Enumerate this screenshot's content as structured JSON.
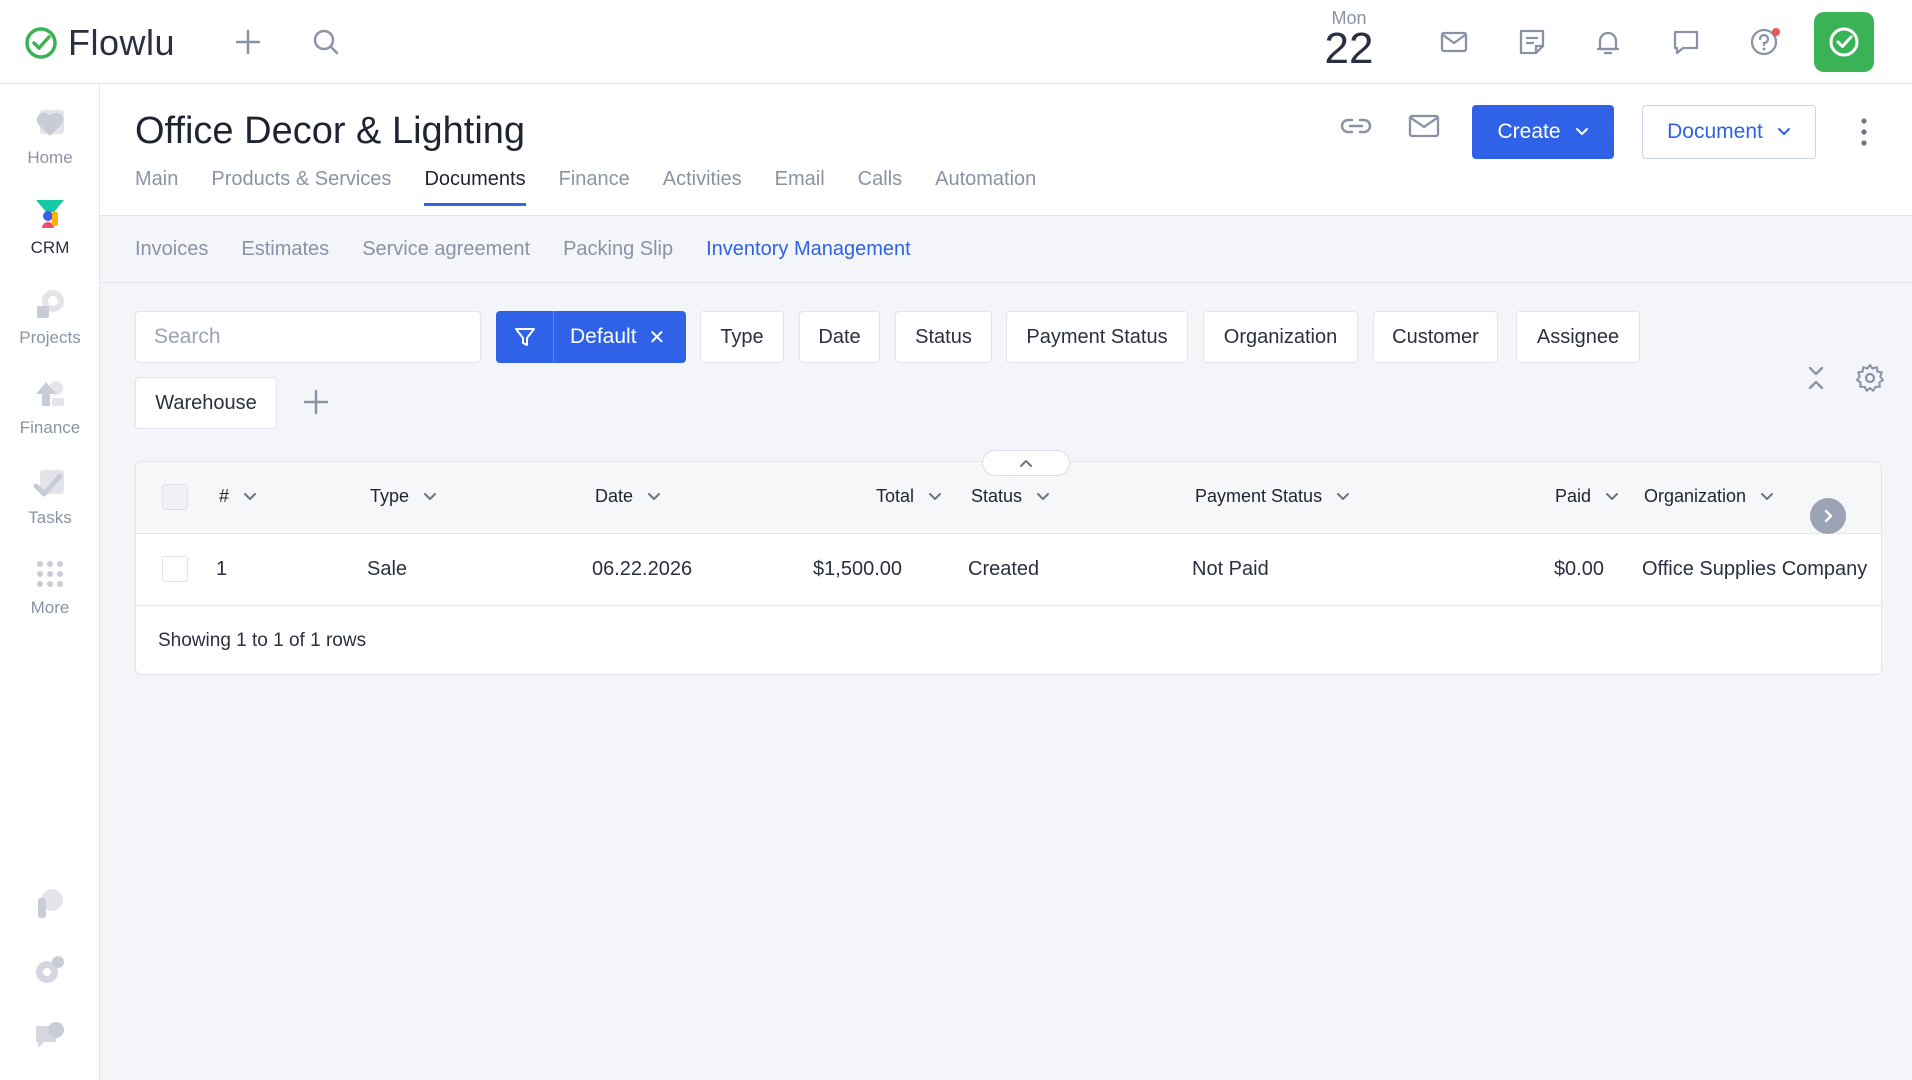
{
  "app": {
    "name": "Flowlu"
  },
  "topbar": {
    "date_day": "Mon",
    "date_num": "22",
    "icons": [
      "add-icon",
      "search-icon",
      "mail-icon",
      "notes-icon",
      "bell-icon",
      "chat-icon",
      "help-icon",
      "check-icon"
    ]
  },
  "sidebar": {
    "items": [
      {
        "label": "Home",
        "icon": "heart-icon"
      },
      {
        "label": "CRM",
        "icon": "funnel-icon"
      },
      {
        "label": "Projects",
        "icon": "projects-icon"
      },
      {
        "label": "Finance",
        "icon": "finance-icon"
      },
      {
        "label": "Tasks",
        "icon": "tasks-icon"
      },
      {
        "label": "More",
        "icon": "grid-icon"
      }
    ]
  },
  "header": {
    "title": "Office Decor & Lighting",
    "tabs": [
      {
        "label": "Main"
      },
      {
        "label": "Products & Services"
      },
      {
        "label": "Documents"
      },
      {
        "label": "Finance"
      },
      {
        "label": "Activities"
      },
      {
        "label": "Email"
      },
      {
        "label": "Calls"
      },
      {
        "label": "Automation"
      }
    ],
    "active_tab": "Documents",
    "create_label": "Create",
    "document_label": "Document"
  },
  "subtabs": {
    "items": [
      {
        "label": "Invoices"
      },
      {
        "label": "Estimates"
      },
      {
        "label": "Service agreement"
      },
      {
        "label": "Packing Slip"
      },
      {
        "label": "Inventory Management"
      }
    ],
    "active": "Inventory Management"
  },
  "filters": {
    "search_placeholder": "Search",
    "default_label": "Default",
    "chips": [
      "Type",
      "Date",
      "Status",
      "Payment Status",
      "Organization",
      "Customer",
      "Assignee",
      "Warehouse"
    ]
  },
  "table": {
    "columns": [
      "#",
      "Type",
      "Date",
      "Total",
      "Status",
      "Payment Status",
      "Paid",
      "Organization"
    ],
    "rows": [
      {
        "num": "1",
        "type": "Sale",
        "date": "06.22.2026",
        "total": "$1,500.00",
        "status": "Created",
        "payment_status": "Not Paid",
        "paid": "$0.00",
        "organization": "Office Supplies Company"
      }
    ],
    "footer": "Showing 1 to 1 of 1 rows"
  },
  "colors": {
    "accent": "#2f62e6",
    "brand_green": "#39b356",
    "muted": "#8a93a6"
  }
}
